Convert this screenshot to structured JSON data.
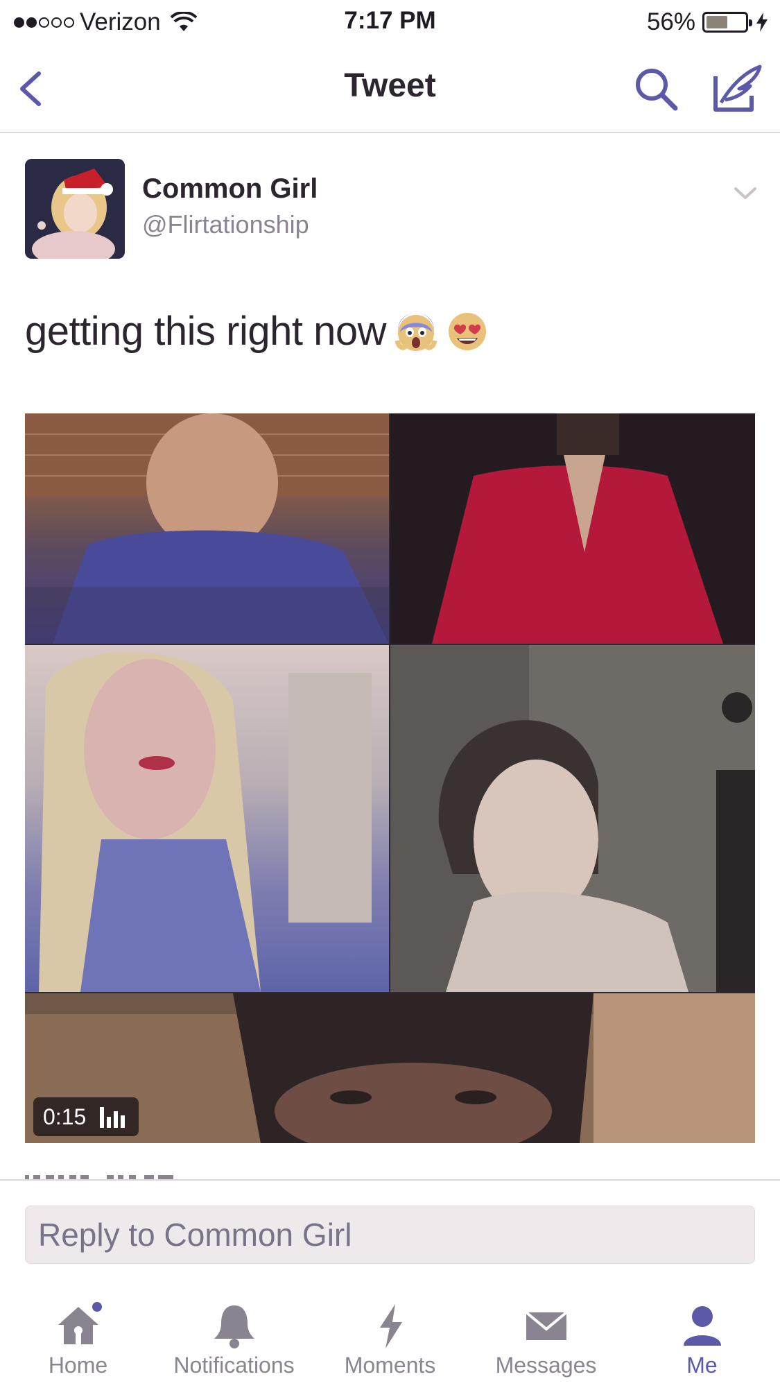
{
  "status_bar": {
    "carrier": "Verizon",
    "time": "7:17 PM",
    "battery": "56%",
    "battery_level": 0.56,
    "signal_bars_filled": 2,
    "signal_bars_total": 5
  },
  "nav": {
    "title": "Tweet",
    "back_icon": "chevron-left-icon",
    "search_icon": "search-icon",
    "compose_icon": "compose-tweet-icon"
  },
  "tweet": {
    "author_name": "Common Girl",
    "author_handle": "@Flirtationship",
    "text": "getting this right now",
    "emojis": [
      "face-screaming-in-fear",
      "smiling-face-with-heart-eyes"
    ],
    "video_duration": "0:15"
  },
  "reply": {
    "placeholder": "Reply to Common Girl"
  },
  "tab_bar": {
    "items": [
      {
        "label": "Home",
        "icon": "home-icon",
        "badge": true
      },
      {
        "label": "Notifications",
        "icon": "bell-icon"
      },
      {
        "label": "Moments",
        "icon": "lightning-icon"
      },
      {
        "label": "Messages",
        "icon": "envelope-icon"
      },
      {
        "label": "Me",
        "icon": "person-icon",
        "active": true
      }
    ]
  },
  "colors": {
    "accent": "#5a5aa8",
    "text": "#2c2530",
    "secondary_text": "#8a8490"
  }
}
